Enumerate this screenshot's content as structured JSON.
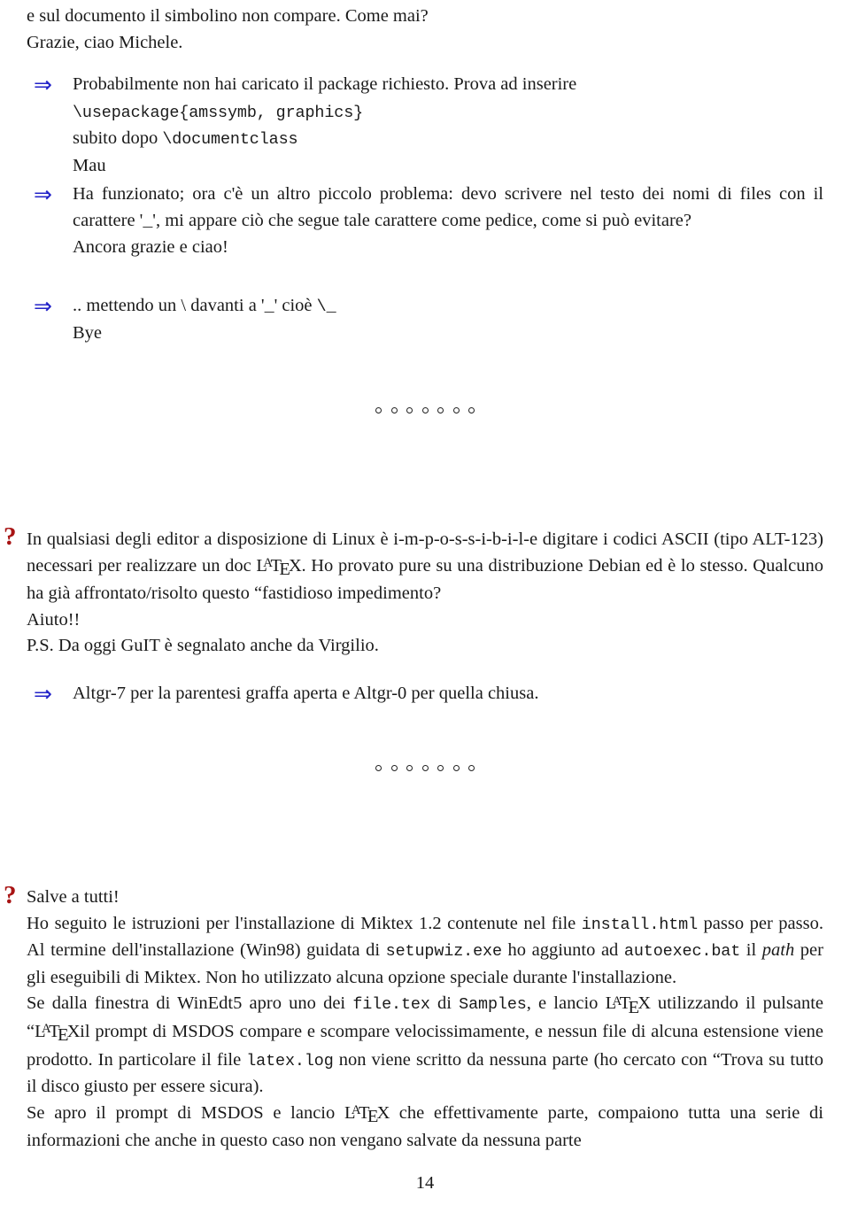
{
  "page": {
    "number": "14",
    "marker_arrow_color": "#2222c8",
    "marker_question_color": "#a81414",
    "text_color": "#1a1a1a"
  },
  "markers": {
    "arrow_glyph": "⇒",
    "question_glyph": "?"
  },
  "messages": [
    {
      "id": "msg-1-continuation",
      "kind": "plain",
      "lines": [
        "e sul documento il simbolino non compare. Come mai?",
        "Grazie, ciao Michele."
      ]
    },
    {
      "id": "msg-2-reply",
      "kind": "arrow-reply",
      "line_1_prefix": "Probabilmente non hai caricato il package richiesto. Prova ad inserire",
      "code_1": "\\usepackage{amssymb, graphics}",
      "line_2_prefix": "subito dopo ",
      "code_2": "\\documentclass",
      "signature": "Mau"
    },
    {
      "id": "msg-3-reply",
      "kind": "arrow-reply",
      "para_part_1": "Ha funzionato; ora c'è un altro piccolo problema: devo scrivere nel testo dei nomi di files con il carattere '",
      "code_underscore": "_",
      "para_part_2": "', mi appare ciò che segue tale carattere come pedice, come si può evitare?",
      "signature": "Ancora grazie e ciao!"
    },
    {
      "id": "msg-4-reply",
      "kind": "arrow-reply",
      "text_part_1": ".. mettendo un \\ davanti a '",
      "code_underscore": "_",
      "text_part_2": "' cioè ",
      "code_tail": "\\_",
      "signature": "Bye"
    },
    {
      "id": "msg-5-question",
      "kind": "question",
      "para_part_1": "In qualsiasi degli editor a disposizione di Linux è i-m-p-o-s-s-i-b-i-l-e digitare i codici ASCII (tipo ALT-123) necessari per realizzare un doc ",
      "latex_logo": "LaTeX",
      "para_part_2": ". Ho provato pure su una distribuzione Debian ed è lo stesso. Qualcuno ha già affrontato/risolto questo “fastidioso impedimento?",
      "line_aiuto": "Aiuto!!",
      "line_ps": "P.S. Da oggi GuIT è segnalato anche da Virgilio."
    },
    {
      "id": "msg-6-reply",
      "kind": "arrow-reply",
      "text": "Altgr-7 per la parentesi graffa aperta e Altgr-0 per quella chiusa."
    },
    {
      "id": "msg-7-question",
      "kind": "question",
      "line_greeting": "Salve a tutti!",
      "p1_a": "Ho seguito le istruzioni per l'installazione di Miktex 1.2 contenute nel file ",
      "p1_code_1": "install.html",
      "p1_b": " passo per passo. Al termine dell'installazione (Win98) guidata di ",
      "p1_code_2": "setupwiz.exe",
      "p1_c": " ho aggiunto ad ",
      "p1_code_3": "autoexec.bat",
      "p1_d": " il ",
      "p1_italic": "path",
      "p1_e": " per gli eseguibili di Miktex. Non ho utilizzato alcuna opzione speciale durante l'installazione.",
      "p2_a": "Se dalla finestra di WinEdt5 apro uno dei ",
      "p2_code_1": "file.tex",
      "p2_b": " di ",
      "p2_code_2": "Samples",
      "p2_c": ", e lancio ",
      "p2_latex_1": "LaTeX",
      "p2_d": " utilizzando il pulsante “",
      "p2_latex_2": "LaTeX",
      "p2_e": "il prompt di MSDOS compare e scompare velocissimamente, e nessun file di alcuna estensione viene prodotto. In particolare il file ",
      "p2_code_3": "latex.log",
      "p2_f": " non viene scritto da nessuna parte (ho cercato con “Trova su tutto il disco giusto per essere sicura).",
      "p3_a": "Se apro il prompt di MSDOS e lancio ",
      "p3_latex": "LaTeX",
      "p3_b": " che effettivamente parte, compaiono tutta una serie di informazioni che anche in questo caso non vengano salvate da nessuna parte"
    }
  ],
  "separators": [
    {
      "id": "separator-1",
      "dots": 7
    },
    {
      "id": "separator-2",
      "dots": 7
    }
  ]
}
